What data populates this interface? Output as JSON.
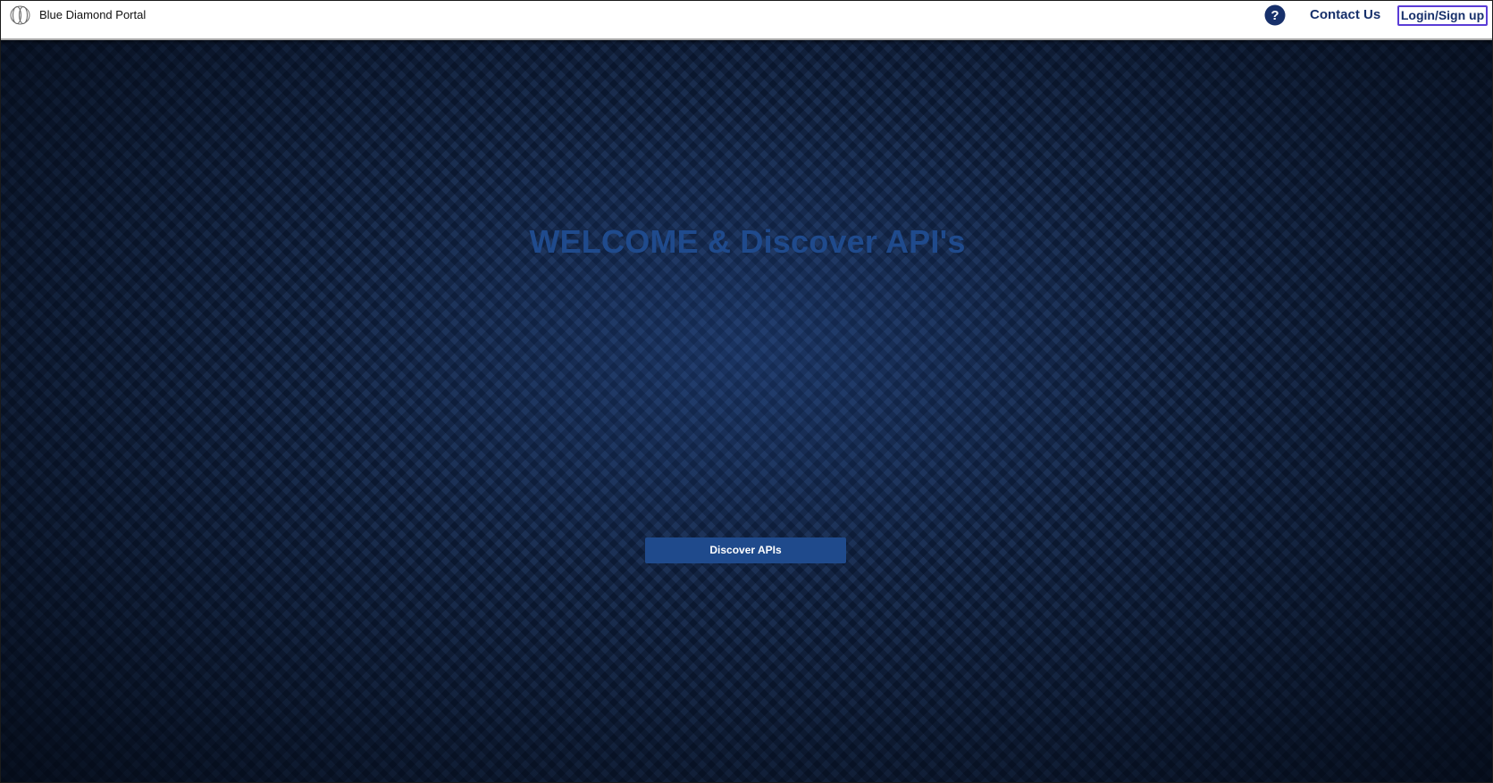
{
  "header": {
    "brand": "Blue Diamond Portal",
    "logo_icon": "oval-rings-logo-icon",
    "help_icon": "question-circle-icon",
    "contact_label": "Contact Us",
    "login_label": "Login/Sign up"
  },
  "hero": {
    "title": "WELCOME & Discover API's",
    "button_label": "Discover APIs"
  },
  "colors": {
    "header_background": "#ffffff",
    "brand_blue": "#1f4a8c",
    "link_blue": "#17306b",
    "login_border": "#5a3cd6",
    "hero_background": "#0f2445"
  }
}
